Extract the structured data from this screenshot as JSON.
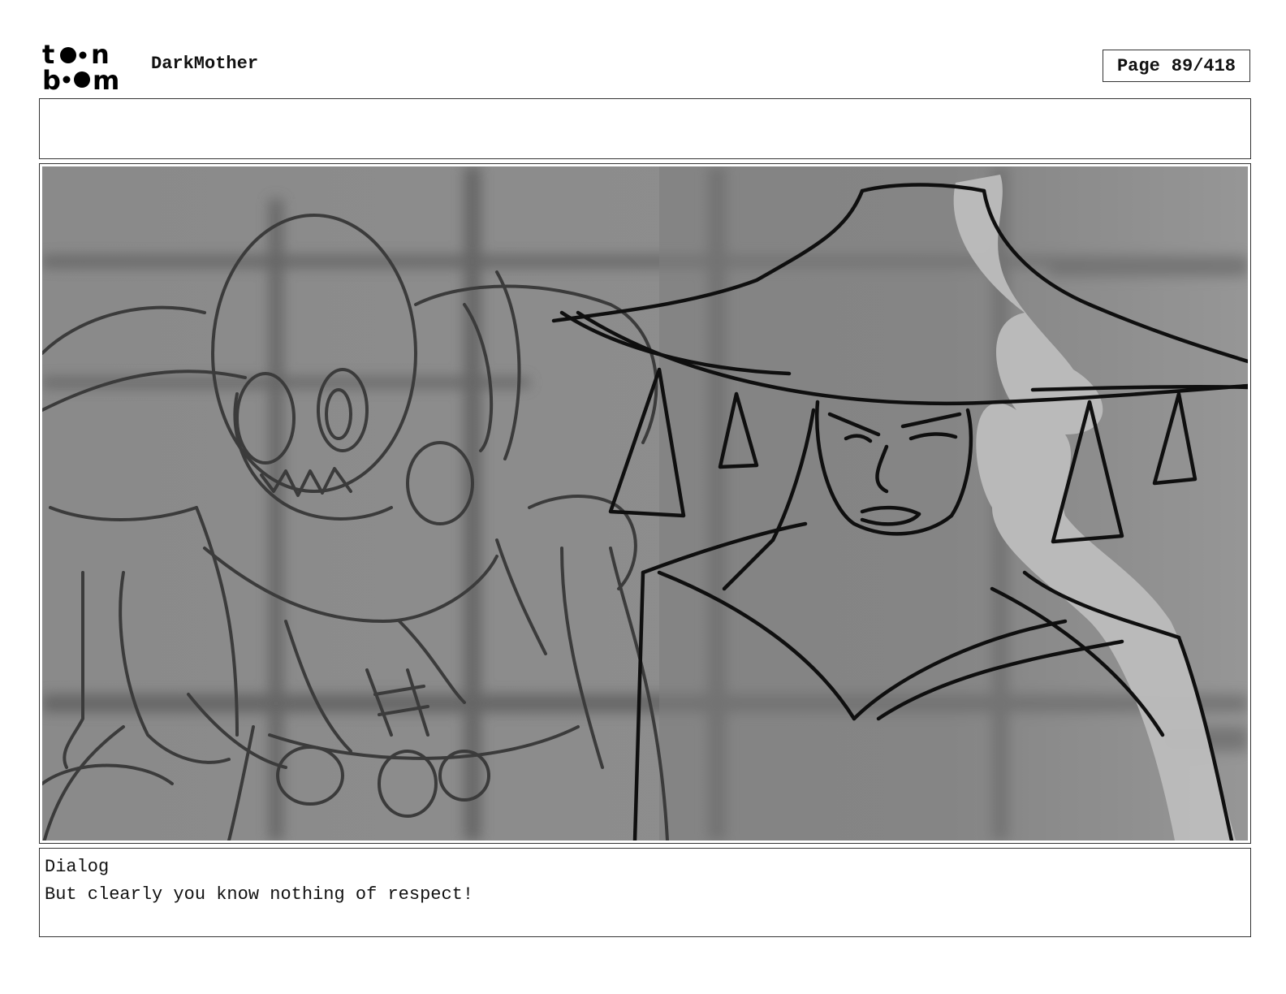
{
  "header": {
    "logo_alt": "toon boom",
    "project_title": "DarkMother",
    "page_label": "Page",
    "page_number": "89/418"
  },
  "notes": {
    "text": ""
  },
  "panel": {
    "icon": "storyboard-sketch"
  },
  "dialog": {
    "label": "Dialog",
    "text": "But clearly you know nothing of respect!"
  }
}
